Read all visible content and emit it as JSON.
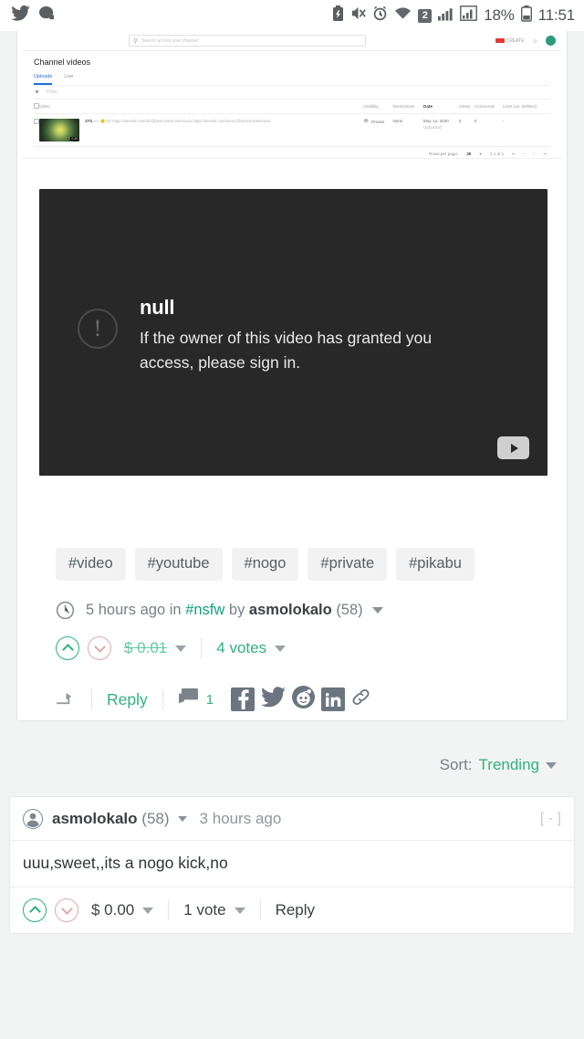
{
  "statusbar": {
    "icons": [
      "twitter-icon",
      "app-icon",
      "battery-saver-icon",
      "mute-icon",
      "alarm-icon",
      "wifi-icon"
    ],
    "sim_badge": "2",
    "battery_percent": "18%",
    "time": "11:51"
  },
  "embed": {
    "alt": "youtube-studio-channel-videos-screenshot",
    "search_placeholder": "Search across your channel",
    "create_label": "CREATE",
    "title": "Channel videos",
    "tabs": [
      {
        "label": "Uploads",
        "active": true
      },
      {
        "label": "Live",
        "active": false
      }
    ],
    "filter_placeholder": "Filter",
    "columns": [
      "Video",
      "Visibility",
      "Restrictions",
      "Date",
      "Views",
      "Comments",
      "Likes (vs. dislikes)"
    ],
    "row": {
      "video_title": "271",
      "video_desc_line1": "ест 🙂 al7 https://steemit.com/dtc/@asmolokalo/semnuda",
      "video_desc_line2": "https://steemit.com/music/@asmolokalo/music",
      "duration": "0:29",
      "visibility": "Private",
      "restrictions": "None",
      "date": "May 14, 2020",
      "date_sub": "Uploaded",
      "views": "2",
      "comments": "0",
      "likes": "-"
    },
    "pager": {
      "rows_per_page_label": "Rows per page:",
      "rows_per_page_value": "30",
      "range": "1-1 of 1"
    }
  },
  "player": {
    "error_title": "null",
    "error_body": "If the owner of this video has granted you access, please sign in.",
    "logo": "youtube-logo"
  },
  "post": {
    "tags": [
      "#video",
      "#youtube",
      "#nogo",
      "#private",
      "#pikabu"
    ],
    "meta": {
      "time": "5 hours ago",
      "in_label": "in",
      "category": "#nsfw",
      "by_label": "by",
      "author": "asmolokalo",
      "reputation": "(58)"
    },
    "vote": {
      "payout": "$ 0.01",
      "votes": "4 votes"
    },
    "actions": {
      "reply": "Reply",
      "comment_count": "1",
      "share_icons": [
        "facebook-icon",
        "twitter-icon",
        "reddit-icon",
        "linkedin-icon",
        "link-icon"
      ]
    }
  },
  "sort": {
    "label": "Sort:",
    "value": "Trending"
  },
  "comment": {
    "author": "asmolokalo",
    "reputation": "(58)",
    "time": "3 hours ago",
    "collapse": "[ - ]",
    "body": "uuu,sweet,,its a nogo kick,no",
    "payout": "$ 0.00",
    "votes": "1 vote",
    "reply": "Reply"
  },
  "colors": {
    "accent_green": "#2fb17f",
    "link_green": "#14a07f",
    "page_bg": "#f2f3f3",
    "card_bg": "#ffffff",
    "muted": "#788187",
    "downvote": "#e0a9ab",
    "social_gray": "#6b7580"
  }
}
